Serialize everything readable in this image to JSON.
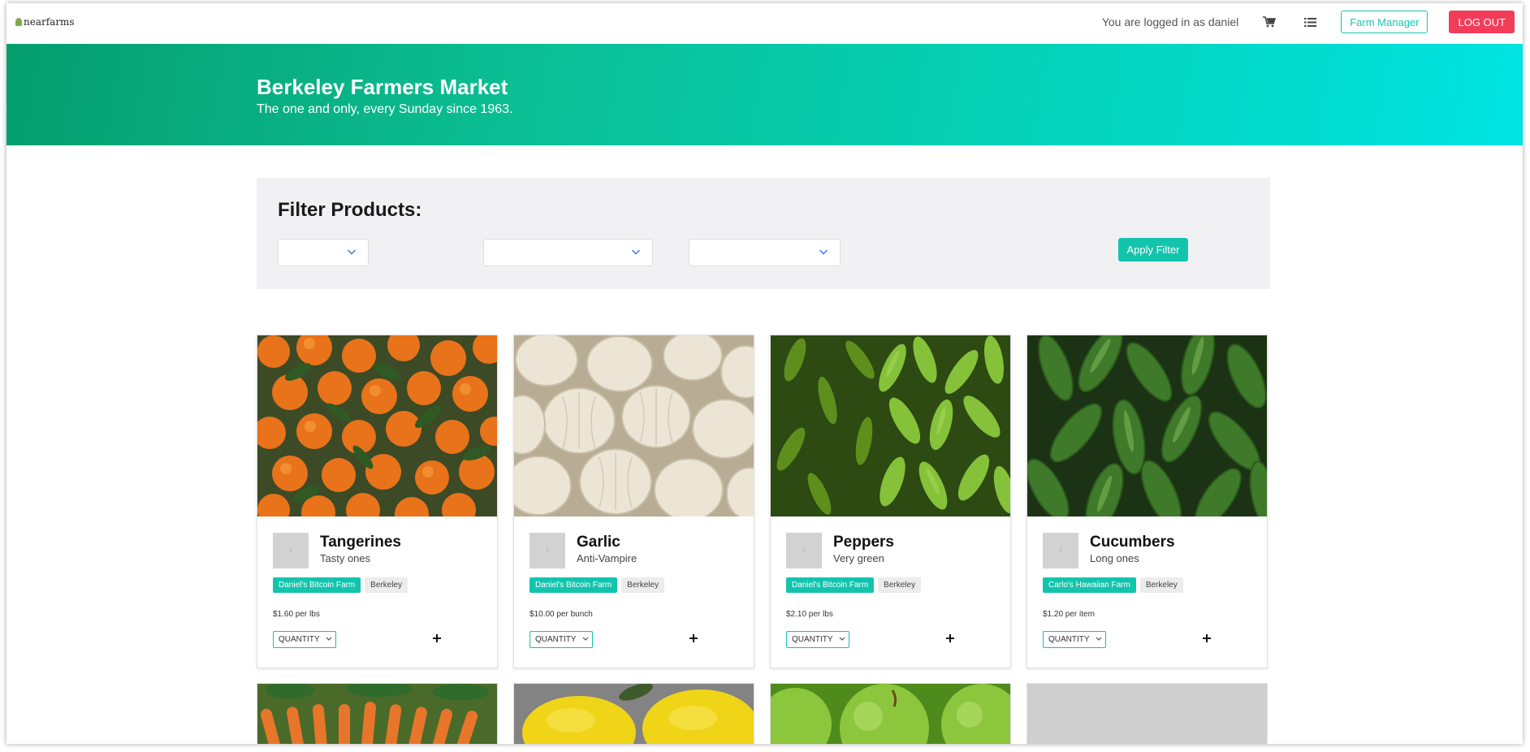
{
  "navbar": {
    "logo_text": "nearfarms",
    "login_text": "You are logged in as daniel",
    "cart_icon": "cart-icon",
    "list_icon": "list-icon",
    "farm_manager_label": "Farm Manager",
    "logout_label": "LOG OUT"
  },
  "hero": {
    "title": "Berkeley Farmers Market",
    "subtitle": "The one and only, every Sunday since 1963.",
    "gradient_start": "#069e6e",
    "gradient_end": "#00e4e2"
  },
  "filter": {
    "title": "Filter Products:",
    "selects": [
      "",
      "",
      ""
    ],
    "apply_label": "Apply Filter"
  },
  "products": [
    {
      "name": "Tangerines",
      "description": "Tasty ones",
      "farm": "Daniel's Bitcoin Farm",
      "location": "Berkeley",
      "price": "$1.60 per lbs",
      "quantity_label": "QUANTITY",
      "image": "tangerines"
    },
    {
      "name": "Garlic",
      "description": "Anti-Vampire",
      "farm": "Daniel's Bitcoin Farm",
      "location": "Berkeley",
      "price": "$10.00 per bunch",
      "quantity_label": "QUANTITY",
      "image": "garlic"
    },
    {
      "name": "Peppers",
      "description": "Very green",
      "farm": "Daniel's Bitcoin Farm",
      "location": "Berkeley",
      "price": "$2.10 per lbs",
      "quantity_label": "QUANTITY",
      "image": "peppers"
    },
    {
      "name": "Cucumbers",
      "description": "Long ones",
      "farm": "Carlo's Hawaiian Farm",
      "location": "Berkeley",
      "price": "$1.20 per item",
      "quantity_label": "QUANTITY",
      "image": "cucumbers"
    }
  ],
  "more_products": [
    "carrots",
    "lemons",
    "green apples",
    "placeholder"
  ],
  "colors": {
    "accent": "#13c4ad",
    "logout": "#f23d5a",
    "filter_bg": "#f1f1f3"
  }
}
